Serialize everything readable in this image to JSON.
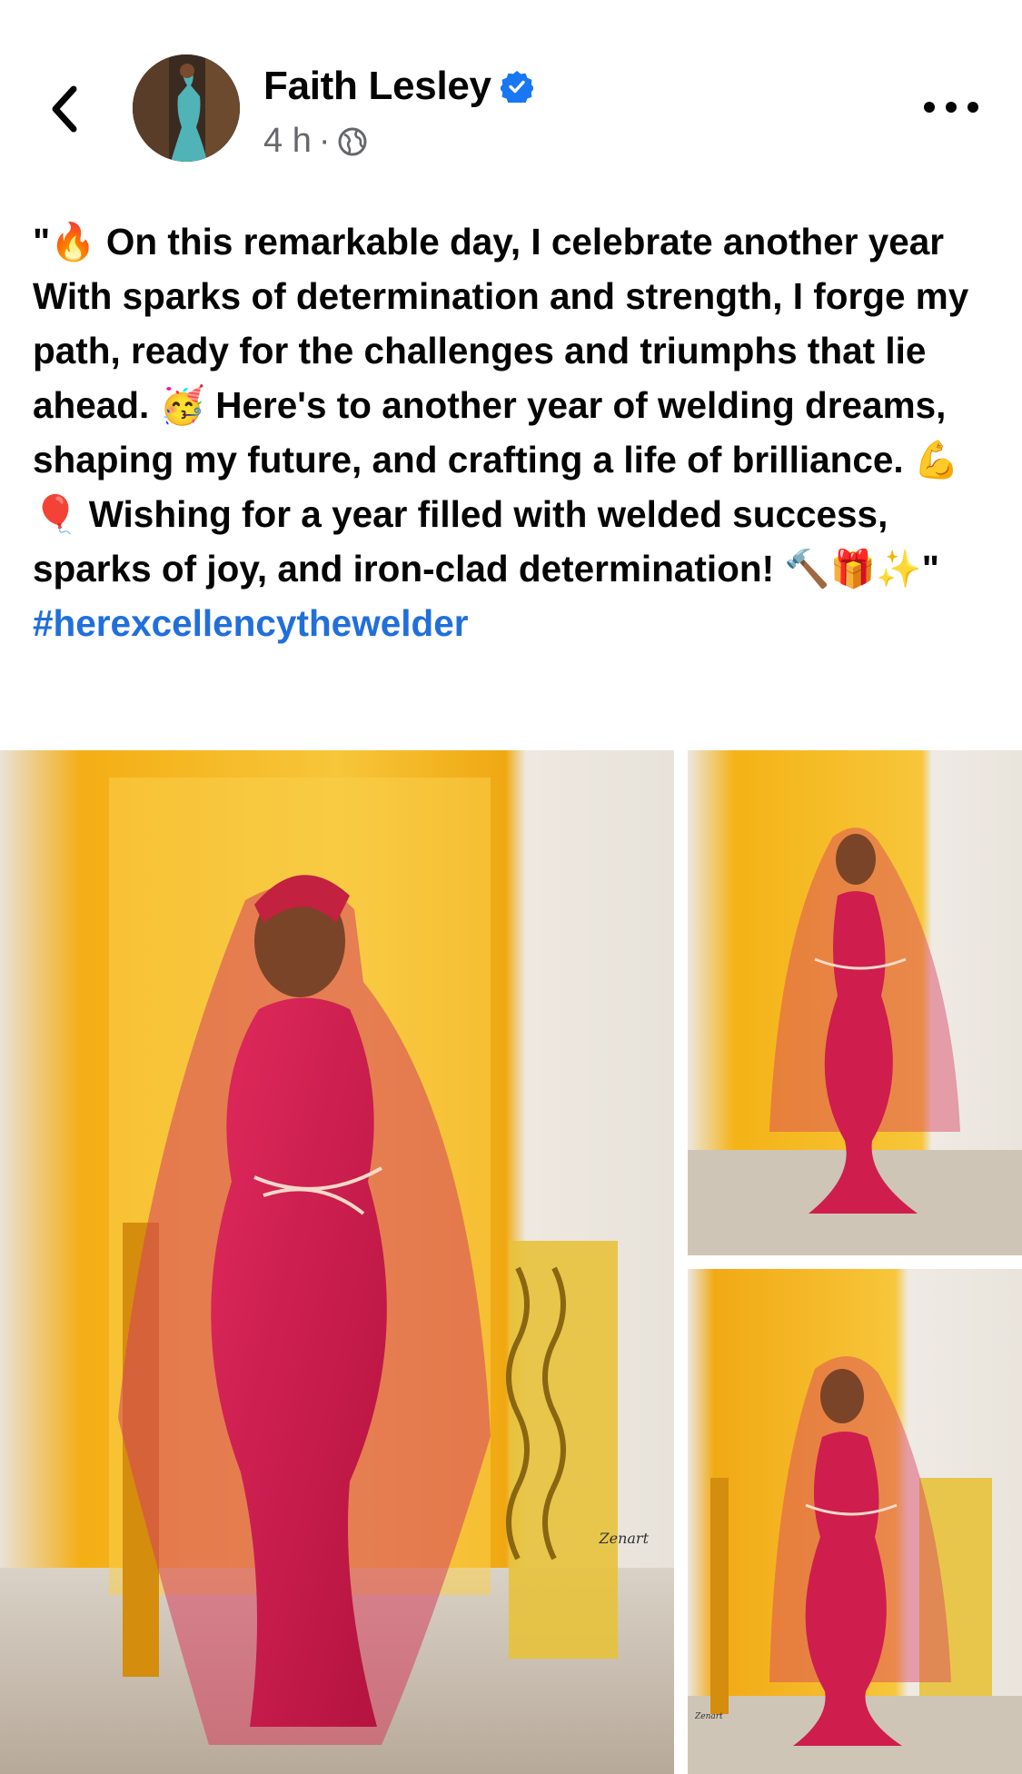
{
  "header": {
    "author_name": "Faith Lesley",
    "time": "4 h",
    "separator": "·",
    "audience_icon": "globe-icon"
  },
  "post": {
    "text_parts": [
      "\"",
      " On this remarkable day, I celebrate another year With sparks of determination and strength, I forge my path, ready for the challenges and triumphs that lie ahead. ",
      " Here's to another year of welding dreams, shaping my future, and crafting a life of brilliance. ",
      "  Wishing for a year filled with welded success, sparks of joy, and iron-clad determination! ",
      "\""
    ],
    "emojis": {
      "fire": "🔥",
      "party": "🥳",
      "muscle": "💪",
      "balloon": "🎈",
      "hammer": "🔨",
      "gift": "🎁",
      "sparkles": "✨"
    },
    "hashtag": "#herexcellencythewelder"
  },
  "photos": {
    "watermark_main": "Zenart",
    "watermark_bottom": "Zenart"
  },
  "colors": {
    "text": "#050505",
    "muted": "#65676b",
    "link": "#216fdb",
    "verified": "#1877f2",
    "dress": "#d11a4f",
    "wall": "#f2b716"
  }
}
